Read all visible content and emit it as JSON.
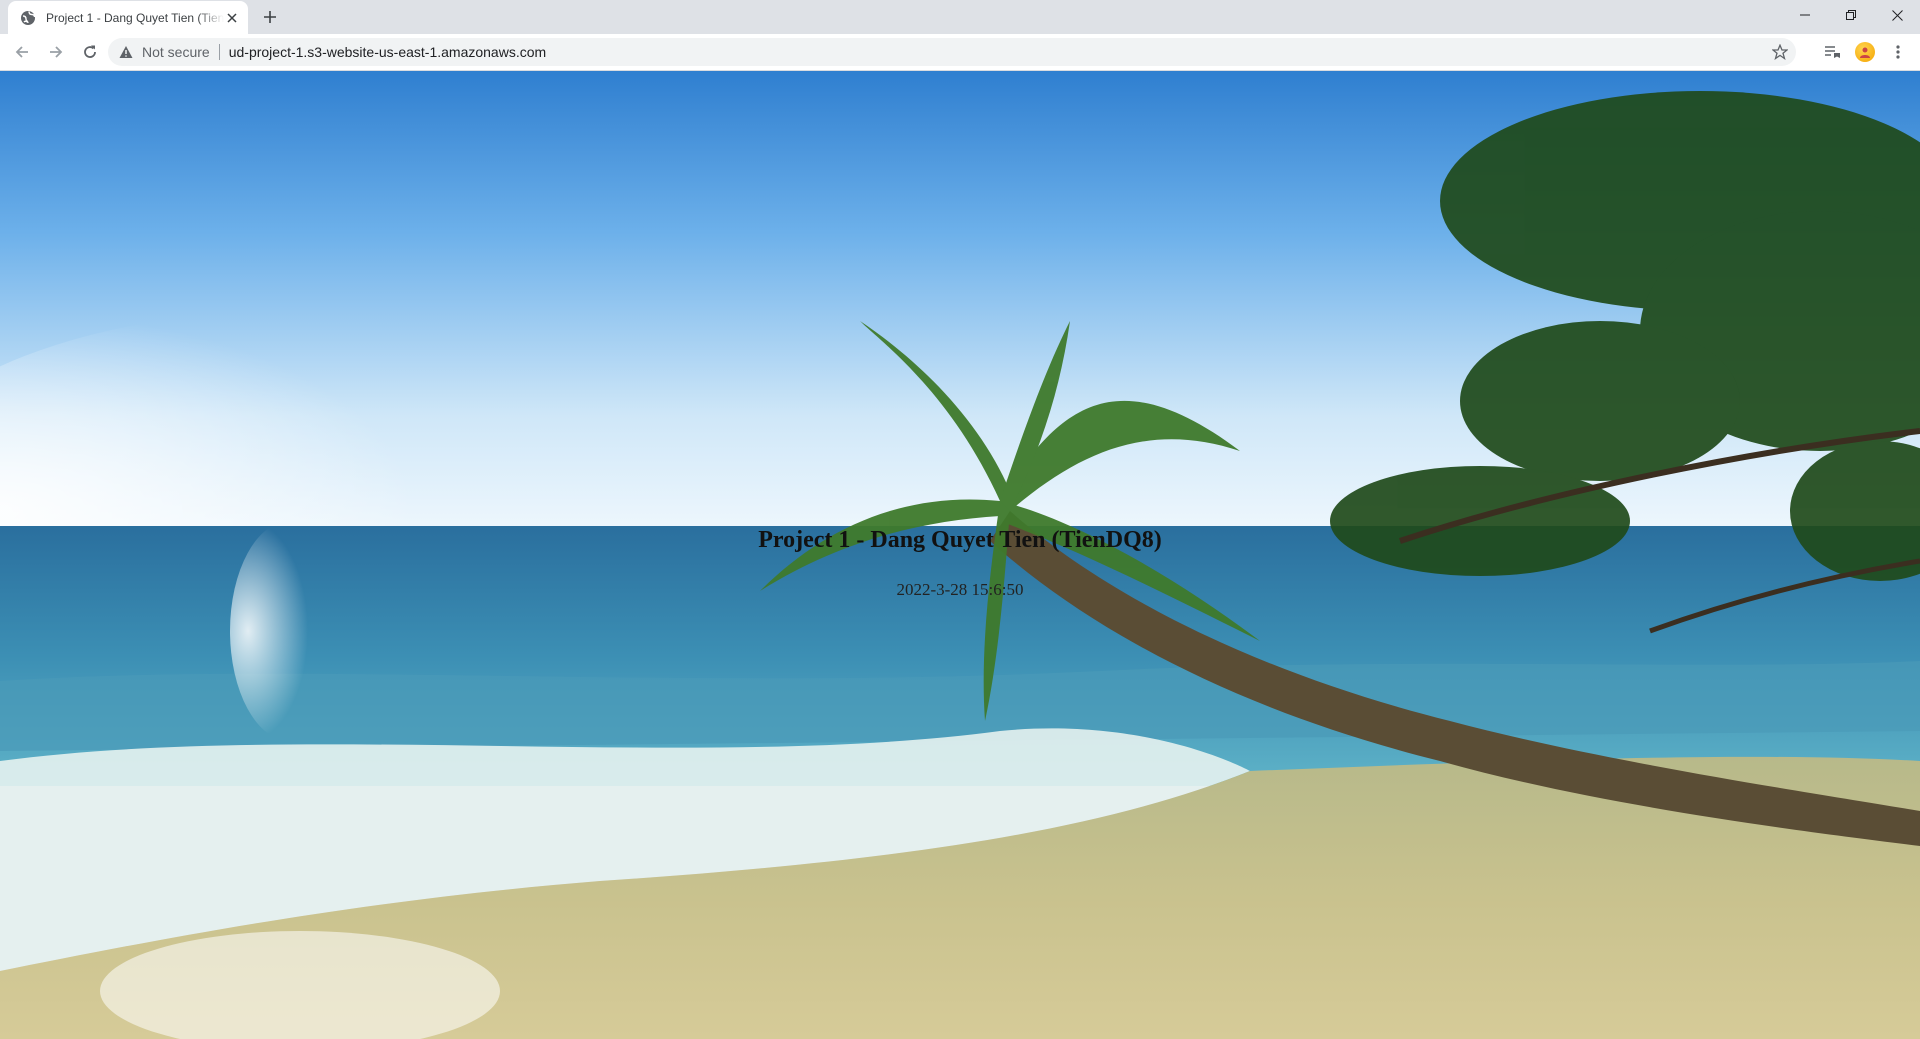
{
  "browser": {
    "tab_title": "Project 1 - Dang Quyet Tien (Tien",
    "security_label": "Not secure",
    "url": "ud-project-1.s3-website-us-east-1.amazonaws.com",
    "icons": [
      "globe-icon",
      "close-icon",
      "plus-icon",
      "minimize-icon",
      "restore-icon",
      "close-window-icon",
      "back-icon",
      "forward-icon",
      "reload-icon",
      "warning-icon",
      "star-icon",
      "reading-list-icon",
      "profile-icon",
      "kebab-menu-icon"
    ]
  },
  "page": {
    "heading": "Project 1 - Dang Quyet Tien (TienDQ8)",
    "date": "2022-3-28 15:6:50"
  },
  "colors": {
    "tab_strip": "#dee1e6",
    "toolbar": "#ffffff",
    "omnibox": "#f1f3f4"
  }
}
